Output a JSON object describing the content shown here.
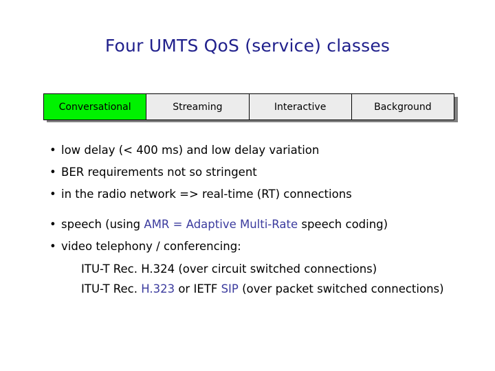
{
  "slide": {
    "title": "Four UMTS QoS (service) classes",
    "title_color": "#20208c",
    "accent_color": "#3b3b9e",
    "highlight_color": "#00f200",
    "background_color": "#ffffff"
  },
  "class_table": {
    "cells": [
      {
        "label": "Conversational",
        "highlighted": true
      },
      {
        "label": "Streaming",
        "highlighted": false
      },
      {
        "label": "Interactive",
        "highlighted": false
      },
      {
        "label": "Background",
        "highlighted": false
      }
    ]
  },
  "bullets_primary": [
    "low delay (< 400 ms) and low delay variation",
    "BER requirements not so stringent",
    "in the radio network => real-time (RT) connections"
  ],
  "bullets_secondary": {
    "speech": {
      "prefix": "speech (using ",
      "accent": "AMR = Adaptive Multi-Rate",
      "suffix": " speech coding)"
    },
    "video": "video telephony / conferencing:"
  },
  "sub_lines": {
    "line1": "ITU-T Rec. H.324 (over circuit switched connections)",
    "line2": {
      "part1": "ITU-T Rec. ",
      "accent1": "H.323",
      "part2": " or IETF ",
      "accent2": "SIP",
      "part3": " (over packet switched connections)"
    }
  }
}
